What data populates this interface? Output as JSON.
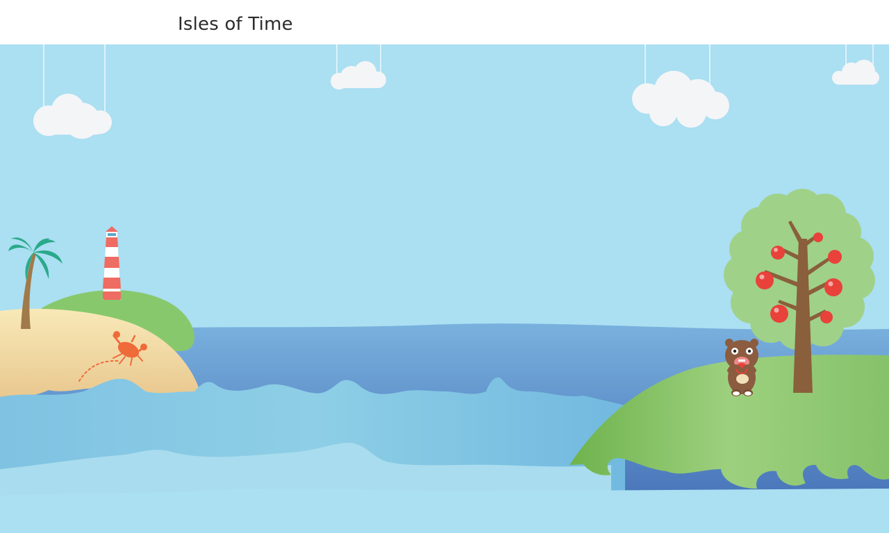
{
  "app": {
    "title": "Isles of Time"
  },
  "colors": {
    "sky": "#abdff2",
    "cloud": "#f4f5f7",
    "sea_deep": "#4c76b8",
    "sea_mid": "#6ea9d8",
    "wave_light": "#b8e3f1",
    "sand": "#f6e3b0",
    "grass": "#8fcb73",
    "lighthouse_red": "#ee6c62",
    "crab": "#ef6b3a",
    "apple": "#e8423a",
    "tree_canopy": "#9fd189",
    "trunk": "#8a5f3b",
    "bear": "#8b5c3f"
  },
  "scene": {
    "clouds": [
      "cloud",
      "cloud",
      "cloud",
      "cloud"
    ],
    "left_island": [
      "palm-tree",
      "lighthouse",
      "crab"
    ],
    "right_island": [
      "apple-tree",
      "bear"
    ],
    "apples_count": 7
  }
}
